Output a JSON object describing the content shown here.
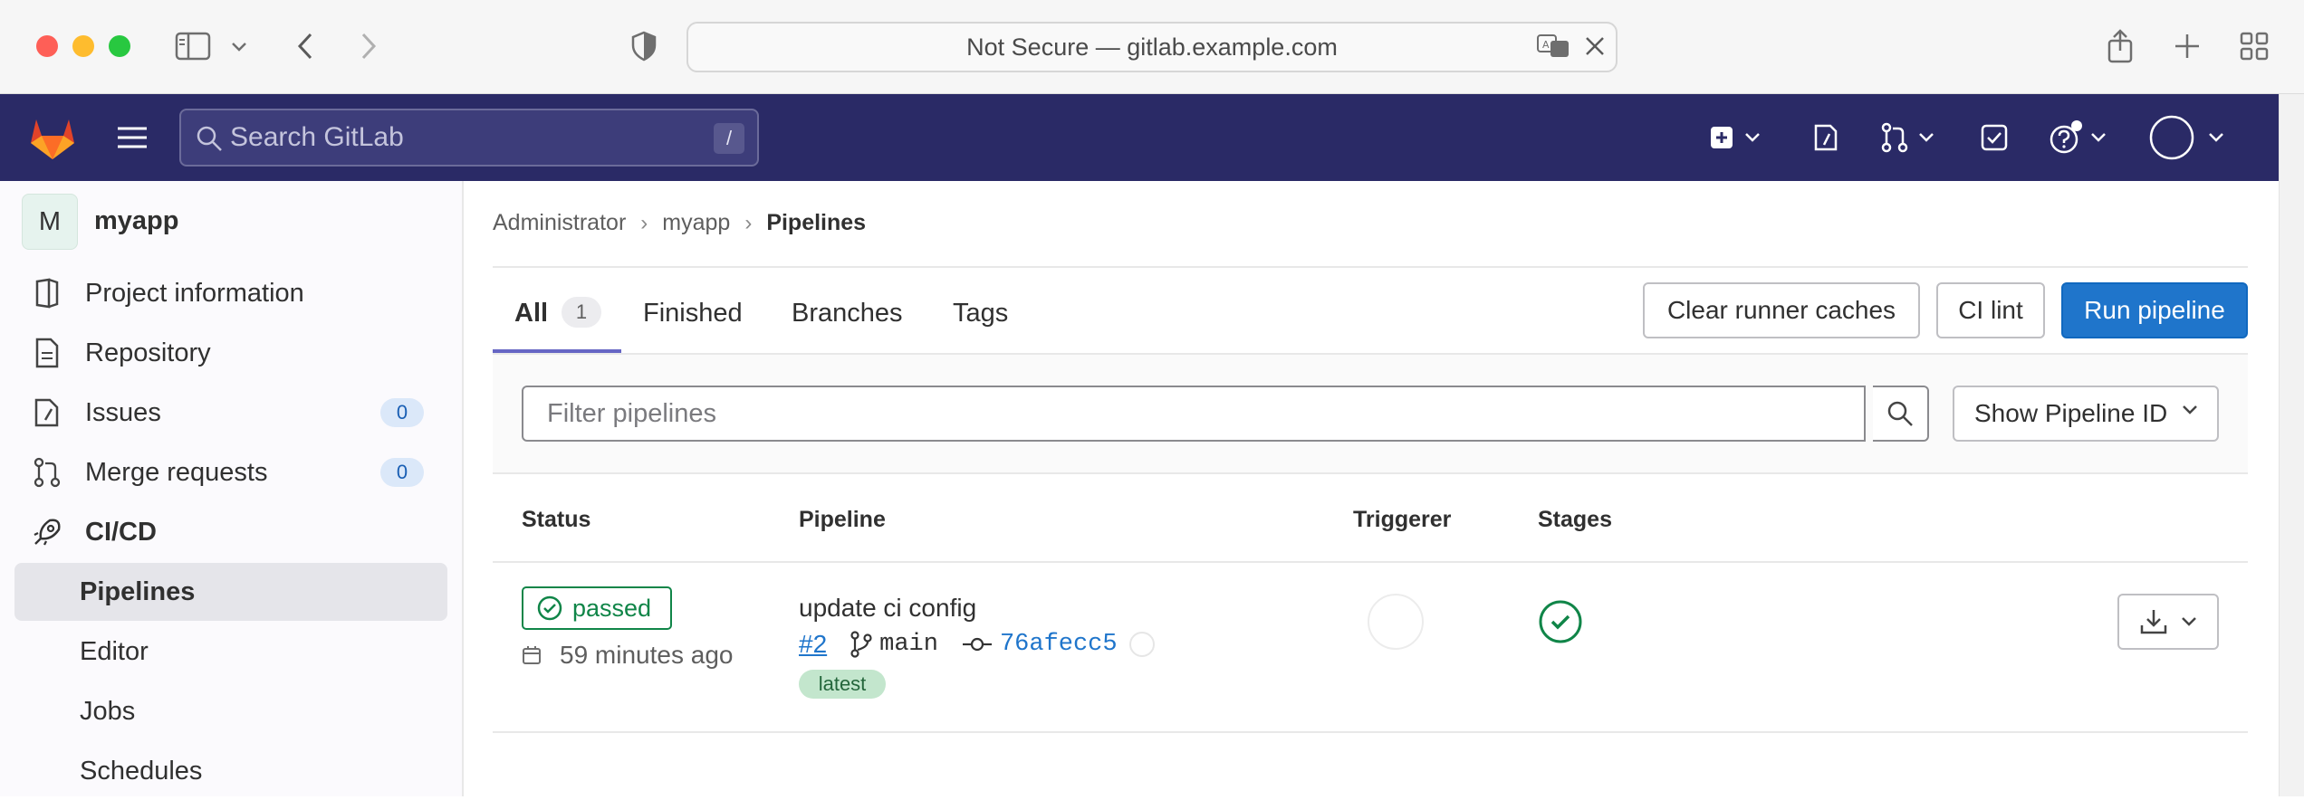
{
  "browser": {
    "url_text": "Not Secure — gitlab.example.com"
  },
  "topnav": {
    "search_placeholder": "Search GitLab",
    "search_shortcut": "/"
  },
  "sidebar": {
    "project_initial": "M",
    "project_name": "myapp",
    "items": [
      {
        "label": "Project information"
      },
      {
        "label": "Repository"
      },
      {
        "label": "Issues",
        "count": "0"
      },
      {
        "label": "Merge requests",
        "count": "0"
      },
      {
        "label": "CI/CD"
      },
      {
        "label": "Pipelines"
      },
      {
        "label": "Editor"
      },
      {
        "label": "Jobs"
      },
      {
        "label": "Schedules"
      }
    ]
  },
  "breadcrumb": {
    "items": [
      "Administrator",
      "myapp",
      "Pipelines"
    ]
  },
  "tabs": {
    "all": "All",
    "all_count": "1",
    "finished": "Finished",
    "branches": "Branches",
    "tags": "Tags"
  },
  "actions": {
    "clear_caches": "Clear runner caches",
    "ci_lint": "CI lint",
    "run_pipeline": "Run pipeline"
  },
  "filter": {
    "placeholder": "Filter pipelines",
    "dropdown_label": "Show Pipeline ID"
  },
  "table": {
    "headers": [
      "Status",
      "Pipeline",
      "Triggerer",
      "Stages"
    ],
    "rows": [
      {
        "status": "passed",
        "time": "59 minutes ago",
        "title": "update ci config",
        "id": "#2",
        "branch": "main",
        "sha": "76afecc5",
        "tag": "latest"
      }
    ]
  },
  "colors": {
    "nav_bg": "#2a2a66",
    "primary": "#1f75cb",
    "success": "#108548"
  }
}
